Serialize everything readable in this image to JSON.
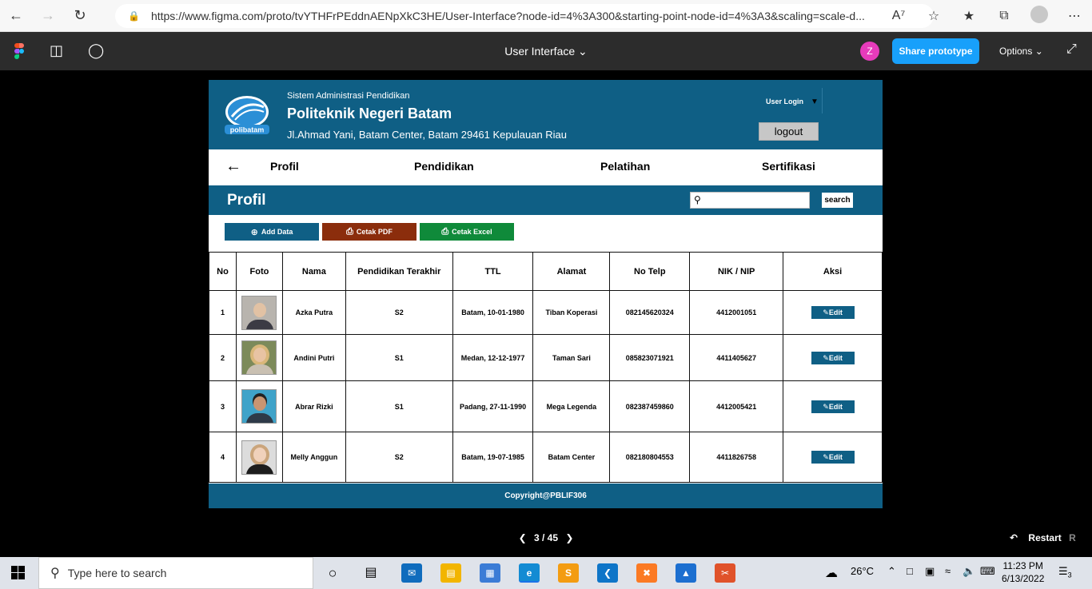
{
  "browser": {
    "url": "https://www.figma.com/proto/tvYTHFrPEddnAENpXkC3HE/User-Interface?node-id=4%3A300&starting-point-node-id=4%3A3&scaling=scale-d..."
  },
  "figma": {
    "file_title": "User Interface",
    "user_initial": "Z",
    "share_label": "Share prototype",
    "options_label": "Options"
  },
  "header": {
    "subtitle": "Sistem Administrasi Pendidikan",
    "title": "Politeknik Negeri Batam",
    "address": "Jl.Ahmad Yani, Batam Center, Batam 29461 Kepulauan Riau",
    "logo_text": "polibatam",
    "user_login": "User Login",
    "logout": "logout"
  },
  "nav": {
    "items": [
      "Profil",
      "Pendidikan",
      "Pelatihan",
      "Sertifikasi"
    ]
  },
  "section": {
    "title": "Profil",
    "search_placeholder": "",
    "search_button": "search"
  },
  "actions": {
    "add": "Add Data",
    "pdf": "Cetak PDF",
    "excel": "Cetak Excel"
  },
  "table": {
    "headers": [
      "No",
      "Foto",
      "Nama",
      "Pendidikan Terakhir",
      "TTL",
      "Alamat",
      "No Telp",
      "NIK / NIP",
      "Aksi"
    ],
    "edit_label": "Edit",
    "rows": [
      {
        "no": "1",
        "nama": "Azka Putra",
        "pendidikan": "S2",
        "ttl": "Batam, 10-01-1980",
        "alamat": "Tiban Koperasi",
        "telp": "082145620324",
        "nik": "4412001051"
      },
      {
        "no": "2",
        "nama": "Andini Putri",
        "pendidikan": "S1",
        "ttl": "Medan, 12-12-1977",
        "alamat": "Taman Sari",
        "telp": "085823071921",
        "nik": "4411405627"
      },
      {
        "no": "3",
        "nama": "Abrar Rizki",
        "pendidikan": "S1",
        "ttl": "Padang, 27-11-1990",
        "alamat": "Mega Legenda",
        "telp": "082387459860",
        "nik": "4412005421"
      },
      {
        "no": "4",
        "nama": "Melly Anggun",
        "pendidikan": "S2",
        "ttl": "Batam, 19-07-1985",
        "alamat": "Batam Center",
        "telp": "082180804553",
        "nik": "4411826758"
      }
    ]
  },
  "footer": {
    "text": "Copyright@PBLIF306"
  },
  "prototype": {
    "page": "3 / 45",
    "restart": "Restart",
    "restart_key": "R"
  },
  "taskbar": {
    "search_placeholder": "Type here to search",
    "temperature": "26°C",
    "time": "11:23 PM",
    "date": "6/13/2022",
    "notification_count": "3"
  },
  "colors": {
    "primary": "#0f5f85",
    "pdf": "#8b2d0c",
    "excel": "#0f8a3a",
    "figma_share": "#18a0fb"
  }
}
